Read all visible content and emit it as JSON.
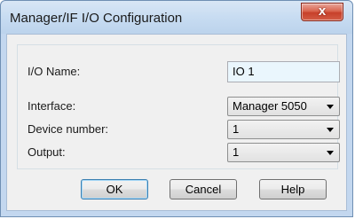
{
  "window": {
    "title": "Manager/IF I/O Configuration",
    "close_glyph": "x"
  },
  "form": {
    "io_name": {
      "label": "I/O Name:",
      "value": "IO 1"
    },
    "interface": {
      "label": "Interface:",
      "value": "Manager 5050"
    },
    "device_number": {
      "label": "Device number:",
      "value": "1"
    },
    "output": {
      "label": "Output:",
      "value": "1"
    }
  },
  "buttons": {
    "ok": "OK",
    "cancel": "Cancel",
    "help": "Help"
  },
  "colors": {
    "titlebar": "#c6dbf1",
    "close_button": "#d9654f",
    "dialog_background": "#f0f0f0"
  },
  "icons": [
    "close-icon",
    "dropdown-arrow-icon"
  ]
}
